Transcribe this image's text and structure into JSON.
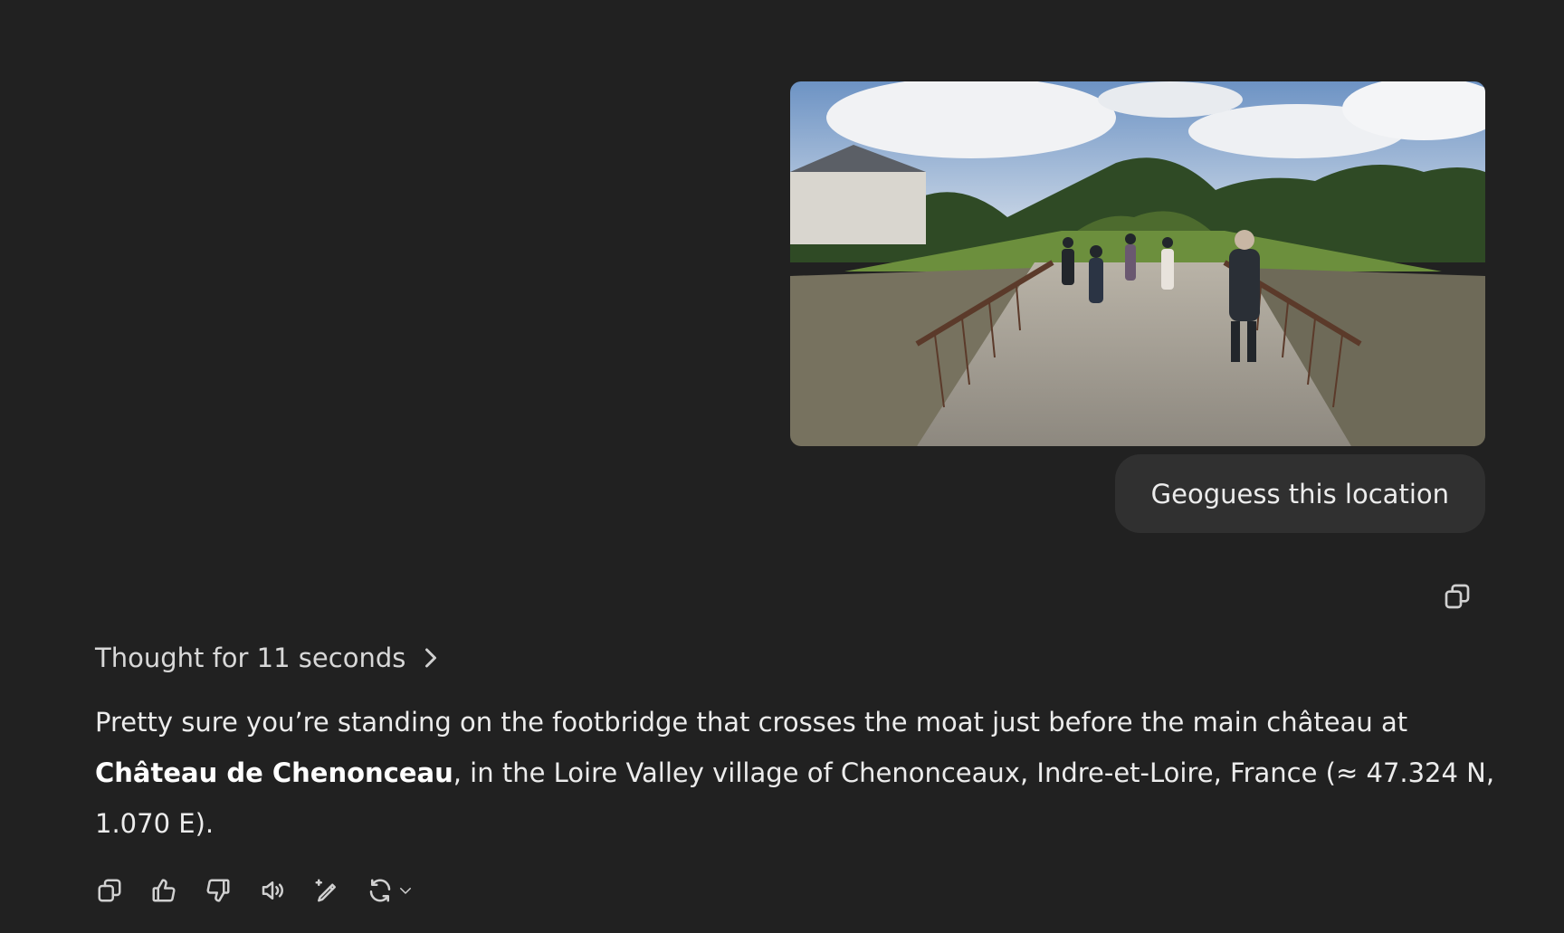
{
  "user_message": {
    "image_icon": "street-view-photo",
    "prompt": "Geoguess this location"
  },
  "assistant": {
    "thought_label": "Thought for 11 seconds",
    "answer_part1": "Pretty sure you’re standing on the footbridge that crosses the moat just before the main château at ",
    "answer_bold": "Château de Chenonceau",
    "answer_part2": ", in the Loire Valley village of Chenonceaux, Indre-et-Loire, France (≈ 47.324 N, 1.070 E)."
  },
  "actions": {
    "icons": [
      "copy-icon",
      "thumbs-up-icon",
      "thumbs-down-icon",
      "read-aloud-icon",
      "edit-sparkle-icon",
      "regenerate-icon",
      "chevron-down-icon"
    ]
  },
  "colors": {
    "background": "#212121",
    "bubble": "#303030",
    "text": "#ececec"
  }
}
